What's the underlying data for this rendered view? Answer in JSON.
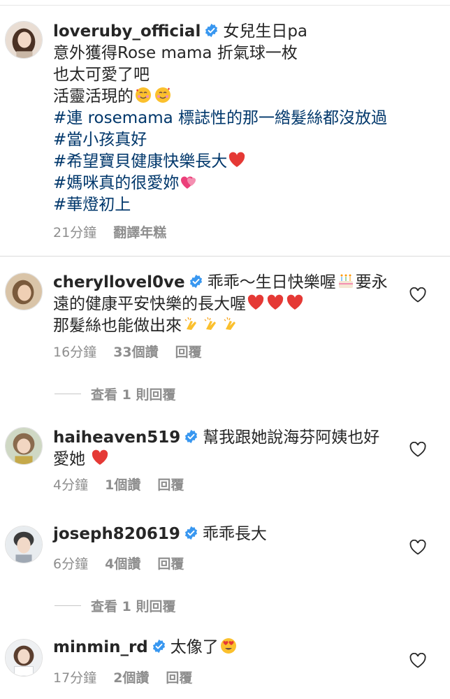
{
  "colors": {
    "text": "#262626",
    "secondary": "#8e8e8e",
    "hashtag": "#00376b",
    "verified": "#3897f0",
    "heart": "#ed4956"
  },
  "caption": {
    "username": "loveruby_official",
    "first_line": "女兒生日pa",
    "lines": [
      "意外獲得Rose  mama 折氣球一枚",
      "也太可愛了吧",
      "活靈活現的"
    ],
    "line3_emojis": [
      "smiling-face-with-hearts",
      "smiling-face-with-hearts"
    ],
    "hashtags": [
      "#連 rosemama 標誌性的那一綹髮絲都沒放過",
      "#當小孩真好",
      "#希望寶貝健康快樂長大",
      "#媽咪真的很愛妳",
      "#華燈初上"
    ],
    "meta": {
      "time": "21分鐘",
      "translate": "翻譯年糕"
    }
  },
  "comments": [
    {
      "username": "cheryllovel0ve",
      "line1": "乖乖～生日快樂喔",
      "line1_tail": "要永",
      "line2": "遠的健康平安快樂的長大喔",
      "line3": "那髮絲也能做出來",
      "time": "16分鐘",
      "likes": "33個讚",
      "reply": "回覆",
      "view_replies": "查看 1 則回覆"
    },
    {
      "username": "haiheaven519",
      "line1": "幫我跟她說海芬阿姨也好",
      "line2": "愛她",
      "time": "4分鐘",
      "likes": "1個讚",
      "reply": "回覆"
    },
    {
      "username": "joseph820619",
      "line1": "乖乖長大",
      "time": "6分鐘",
      "likes": "4個讚",
      "reply": "回覆",
      "view_replies": "查看 1 則回覆"
    },
    {
      "username": "minmin_rd",
      "line1": "太像了",
      "time": "17分鐘",
      "likes": "2個讚",
      "reply": "回覆"
    }
  ]
}
